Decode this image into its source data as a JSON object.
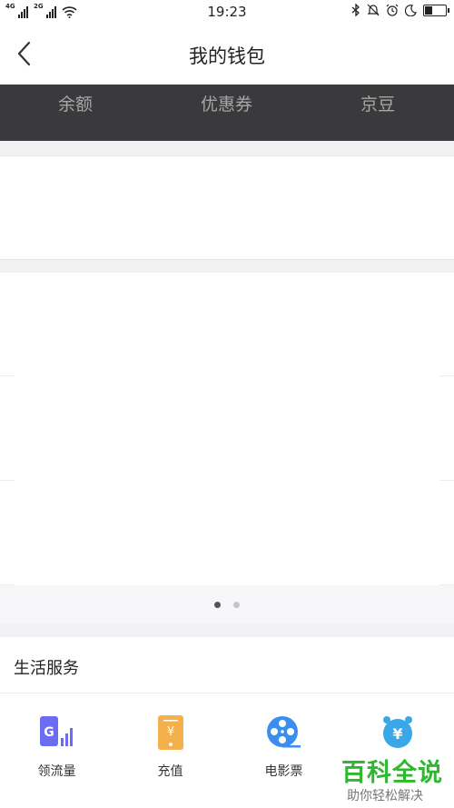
{
  "status": {
    "net1": "4G",
    "net2": "2G",
    "time": "19:23"
  },
  "header": {
    "title": "我的钱包"
  },
  "tabs": [
    {
      "label": "余额"
    },
    {
      "label": "优惠券"
    },
    {
      "label": "京豆"
    }
  ],
  "carousel": {
    "page_count": 2,
    "active_index": 0
  },
  "services": {
    "title": "生活服务",
    "items": [
      {
        "label": "领流量",
        "icon": "data-traffic-icon"
      },
      {
        "label": "充值",
        "icon": "phone-recharge-icon"
      },
      {
        "label": "电影票",
        "icon": "film-reel-icon"
      },
      {
        "label": "",
        "icon": "alarm-yen-icon"
      }
    ]
  },
  "watermark": {
    "brand": "百科全说",
    "slogan": "助你轻松解决"
  },
  "colors": {
    "tab_bar": "#3a3a3c",
    "tab_text": "#a6a6a6",
    "purple": "#6b6cf2",
    "orange": "#f3b04b",
    "blue": "#3a8ef0",
    "watermark_green": "#2eb82e"
  }
}
